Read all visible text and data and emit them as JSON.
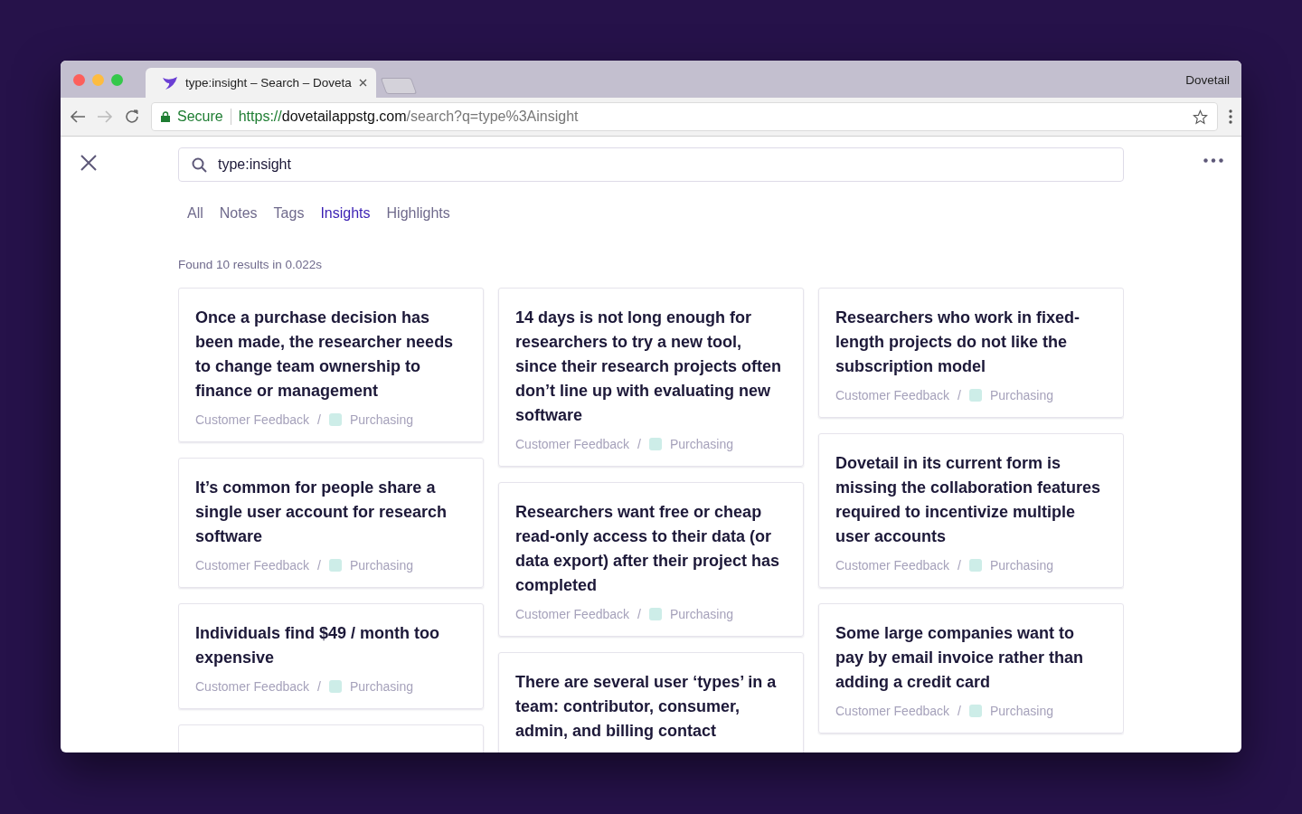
{
  "browser": {
    "tab_title": "type:insight – Search – Doveta",
    "profile": "Dovetail",
    "secure_label": "Secure",
    "url_scheme": "https://",
    "url_host": "dovetailappstg.com",
    "url_path": "/search?q=type%3Ainsight"
  },
  "search": {
    "value": "type:insight"
  },
  "filters": [
    {
      "label": "All",
      "selected": false
    },
    {
      "label": "Notes",
      "selected": false
    },
    {
      "label": "Tags",
      "selected": false
    },
    {
      "label": "Insights",
      "selected": true
    },
    {
      "label": "Highlights",
      "selected": false
    }
  ],
  "result_summary": "Found 10 results in 0.022s",
  "columns": [
    {
      "cards": [
        {
          "kind": "insight",
          "title": "Once a purchase decision has been made, the researcher needs to change team ownership to finance or management",
          "project": "Customer Feedback",
          "separator": "/",
          "tag": "Purchasing",
          "color": "#cdede8"
        },
        {
          "kind": "insight",
          "title": "It’s common for people share a single user account for research software",
          "project": "Customer Feedback",
          "separator": "/",
          "tag": "Purchasing",
          "color": "#cdede8"
        },
        {
          "kind": "insight",
          "title": "Individuals find $49 / month too expensive",
          "project": "Customer Feedback",
          "separator": "/",
          "tag": "Purchasing",
          "color": "#cdede8"
        },
        {
          "kind": "clipped"
        }
      ]
    },
    {
      "cards": [
        {
          "kind": "insight",
          "title": "14 days is not long enough for researchers to try a new tool, since their research projects often don’t line up with evaluating new software",
          "project": "Customer Feedback",
          "separator": "/",
          "tag": "Purchasing",
          "color": "#cdede8"
        },
        {
          "kind": "insight",
          "title": "Researchers want free or cheap read-only access to their data (or data export) after their project has completed",
          "project": "Customer Feedback",
          "separator": "/",
          "tag": "Purchasing",
          "color": "#cdede8"
        },
        {
          "kind": "insight",
          "title": "There are several user ‘types’ in a team: contributor, consumer, admin, and billing contact"
        }
      ]
    },
    {
      "cards": [
        {
          "kind": "insight",
          "title": "Researchers who work in fixed-length projects do not like the subscription model",
          "project": "Customer Feedback",
          "separator": "/",
          "tag": "Purchasing",
          "color": "#cdede8"
        },
        {
          "kind": "insight",
          "title": "Dovetail in its current form is missing the collaboration features required to incentivize multiple user accounts",
          "project": "Customer Feedback",
          "separator": "/",
          "tag": "Purchasing",
          "color": "#cdede8"
        },
        {
          "kind": "insight",
          "title": "Some large companies want to pay by email invoice rather than adding a credit card",
          "project": "Customer Feedback",
          "separator": "/",
          "tag": "Purchasing",
          "color": "#cdede8"
        }
      ]
    }
  ]
}
